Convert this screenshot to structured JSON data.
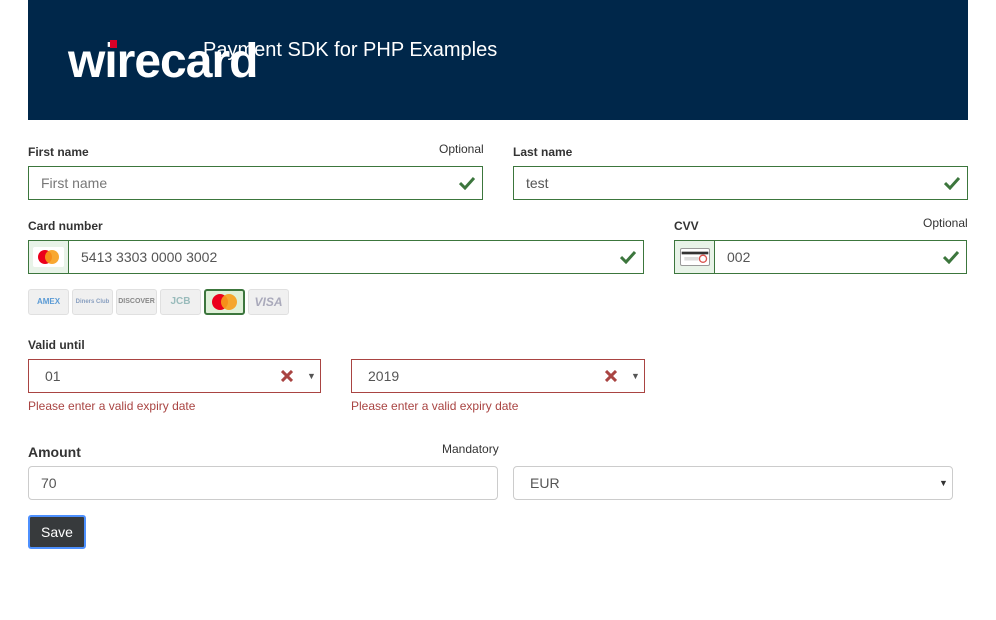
{
  "header": {
    "logo": "wirecard",
    "title": "Payment SDK for PHP Examples"
  },
  "form": {
    "first_name": {
      "label": "First name",
      "hint": "Optional",
      "placeholder": "First name",
      "value": ""
    },
    "last_name": {
      "label": "Last name",
      "value": "test"
    },
    "card_number": {
      "label": "Card number",
      "value": "5413 3303 0000 3002"
    },
    "cvv": {
      "label": "CVV",
      "hint": "Optional",
      "value": "002"
    },
    "brands": [
      "AMEX",
      "Diners Club",
      "DISCOVER",
      "JCB",
      "MasterCard",
      "VISA"
    ],
    "active_brand": "MasterCard",
    "valid_until": {
      "label": "Valid until",
      "month": "01",
      "year": "2019",
      "error": "Please enter a valid expiry date"
    },
    "amount": {
      "label": "Amount",
      "hint": "Mandatory",
      "value": "70"
    },
    "currency": {
      "value": "EUR"
    },
    "save_label": "Save"
  },
  "colors": {
    "header_bg": "#00274a",
    "valid": "#3c763d",
    "invalid": "#a94442",
    "button_bg": "#373a3c",
    "logo_accent": "#d90027"
  }
}
